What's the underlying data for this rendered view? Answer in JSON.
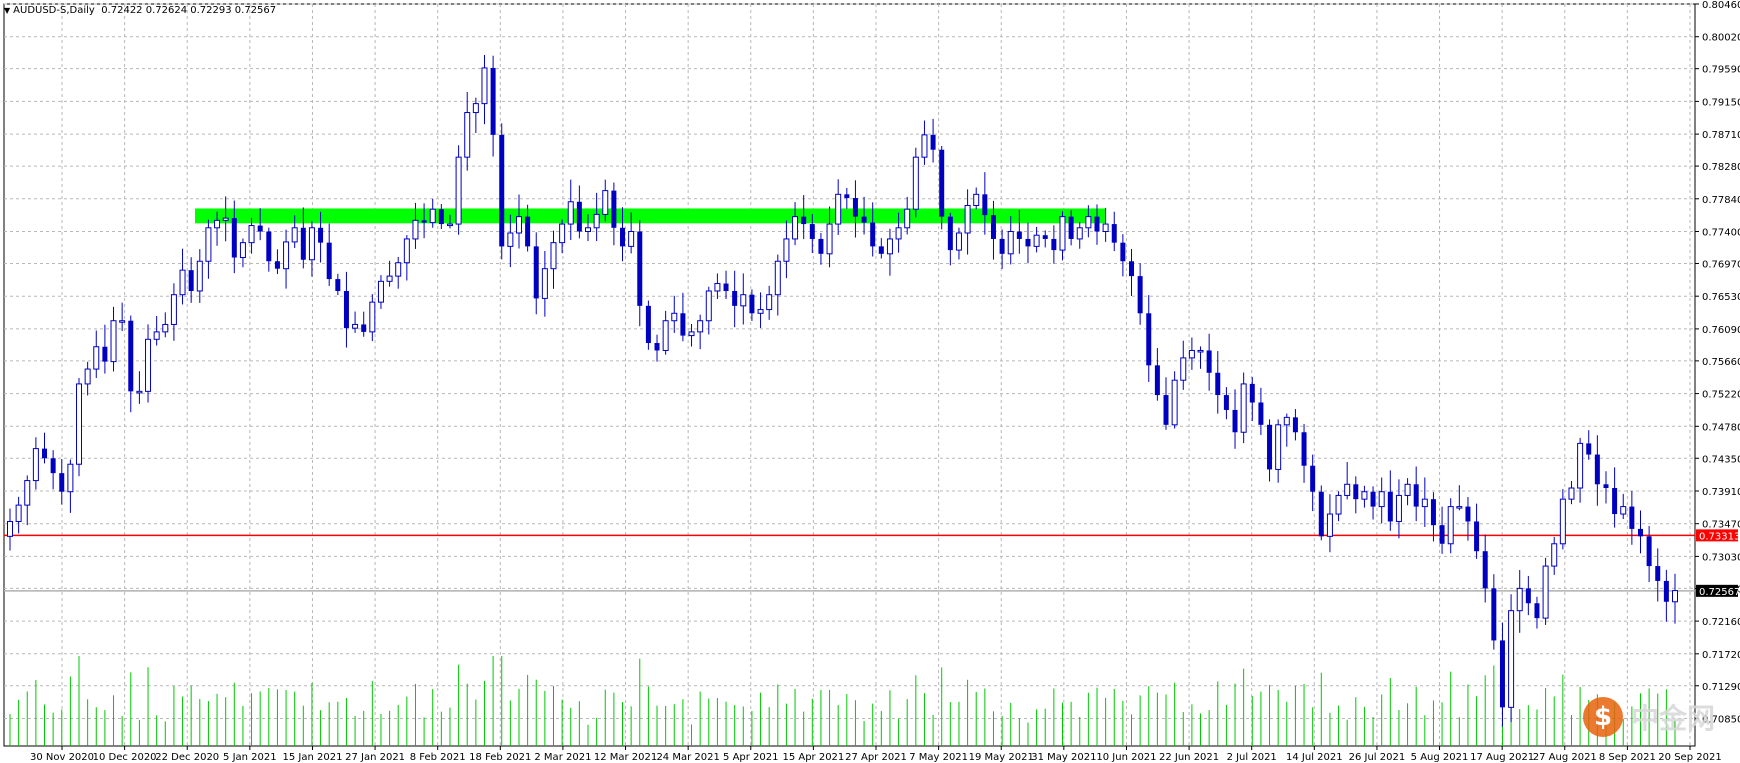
{
  "header": {
    "symbol": "AUDUSD-S,Daily",
    "ohlc": "0.72422 0.72624 0.72293 0.72567"
  },
  "colors": {
    "candle": "#0000c0",
    "volume": "#00c800",
    "grid": "#b8b8b8",
    "zone": "#00ff00",
    "hline": "#ff0000",
    "bid": "#b0b0b0"
  },
  "watermark": {
    "text": "中金网"
  },
  "chart_data": {
    "type": "candlestick",
    "title": "AUDUSD-S,Daily",
    "ylim": [
      0.7048,
      0.8046
    ],
    "y_ticks": [
      "0.80460",
      "0.80020",
      "0.79590",
      "0.79150",
      "0.78710",
      "0.78280",
      "0.77840",
      "0.77400",
      "0.76970",
      "0.76530",
      "0.76090",
      "0.75660",
      "0.75220",
      "0.74780",
      "0.74350",
      "0.73910",
      "0.73470",
      "0.73030",
      "0.72600",
      "0.72160",
      "0.71720",
      "0.71290",
      "0.70850"
    ],
    "x_ticks": [
      "30 Nov 2020",
      "10 Dec 2020",
      "22 Dec 2020",
      "5 Jan 2021",
      "15 Jan 2021",
      "27 Jan 2021",
      "8 Feb 2021",
      "18 Feb 2021",
      "2 Mar 2021",
      "12 Mar 2021",
      "24 Mar 2021",
      "5 Apr 2021",
      "15 Apr 2021",
      "27 Apr 2021",
      "7 May 2021",
      "19 May 2021",
      "31 May 2021",
      "10 Jun 2021",
      "22 Jun 2021",
      "2 Jul 2021",
      "14 Jul 2021",
      "26 Jul 2021",
      "5 Aug 2021",
      "17 Aug 2021",
      "27 Aug 2021",
      "8 Sep 2021",
      "20 Sep 2021"
    ],
    "horizontal_line": {
      "price": 0.73313,
      "label": "0.73313"
    },
    "bid_line": {
      "price": 0.72567,
      "label": "0.72567"
    },
    "resistance_zone": {
      "low": 0.7751,
      "high": 0.7771
    },
    "closes": [
      0.735,
      0.7372,
      0.7405,
      0.7448,
      0.7435,
      0.7415,
      0.739,
      0.7427,
      0.7535,
      0.7555,
      0.7585,
      0.7565,
      0.762,
      0.762,
      0.7525,
      0.7525,
      0.7595,
      0.7605,
      0.7615,
      0.7655,
      0.7688,
      0.766,
      0.77,
      0.7745,
      0.7755,
      0.7758,
      0.7705,
      0.7725,
      0.7748,
      0.774,
      0.77,
      0.769,
      0.7726,
      0.7745,
      0.7702,
      0.7745,
      0.7725,
      0.7676,
      0.766,
      0.761,
      0.7615,
      0.7605,
      0.7645,
      0.7673,
      0.768,
      0.7698,
      0.773,
      0.7755,
      0.7752,
      0.777,
      0.775,
      0.775,
      0.784,
      0.79,
      0.7912,
      0.796,
      0.787,
      0.772,
      0.7738,
      0.776,
      0.772,
      0.765,
      0.769,
      0.7725,
      0.775,
      0.778,
      0.774,
      0.7745,
      0.7763,
      0.7795,
      0.7745,
      0.772,
      0.774,
      0.764,
      0.759,
      0.758,
      0.762,
      0.763,
      0.76,
      0.7605,
      0.762,
      0.766,
      0.767,
      0.766,
      0.764,
      0.7655,
      0.763,
      0.7635,
      0.7655,
      0.77,
      0.773,
      0.776,
      0.775,
      0.773,
      0.771,
      0.775,
      0.779,
      0.7785,
      0.776,
      0.7752,
      0.772,
      0.771,
      0.773,
      0.7745,
      0.777,
      0.784,
      0.787,
      0.785,
      0.776,
      0.7715,
      0.7738,
      0.7775,
      0.779,
      0.7762,
      0.773,
      0.771,
      0.774,
      0.773,
      0.772,
      0.7735,
      0.773,
      0.7715,
      0.776,
      0.773,
      0.7745,
      0.776,
      0.774,
      0.775,
      0.7725,
      0.77,
      0.768,
      0.763,
      0.756,
      0.752,
      0.748,
      0.754,
      0.757,
      0.758,
      0.758,
      0.755,
      0.752,
      0.75,
      0.747,
      0.7535,
      0.751,
      0.748,
      0.742,
      0.748,
      0.749,
      0.747,
      0.7425,
      0.739,
      0.733,
      0.736,
      0.7385,
      0.74,
      0.738,
      0.739,
      0.737,
      0.739,
      0.735,
      0.7385,
      0.74,
      0.737,
      0.738,
      0.7345,
      0.732,
      0.737,
      0.737,
      0.735,
      0.731,
      0.726,
      0.719,
      0.71,
      0.723,
      0.726,
      0.724,
      0.722,
      0.729,
      0.732,
      0.738,
      0.7395,
      0.7455,
      0.744,
      0.74,
      0.7395,
      0.736,
      0.737,
      0.734,
      0.733,
      0.729,
      0.727,
      0.7242,
      0.7257
    ],
    "volume_tallest_bar_fraction_of_pane": 1.0
  }
}
